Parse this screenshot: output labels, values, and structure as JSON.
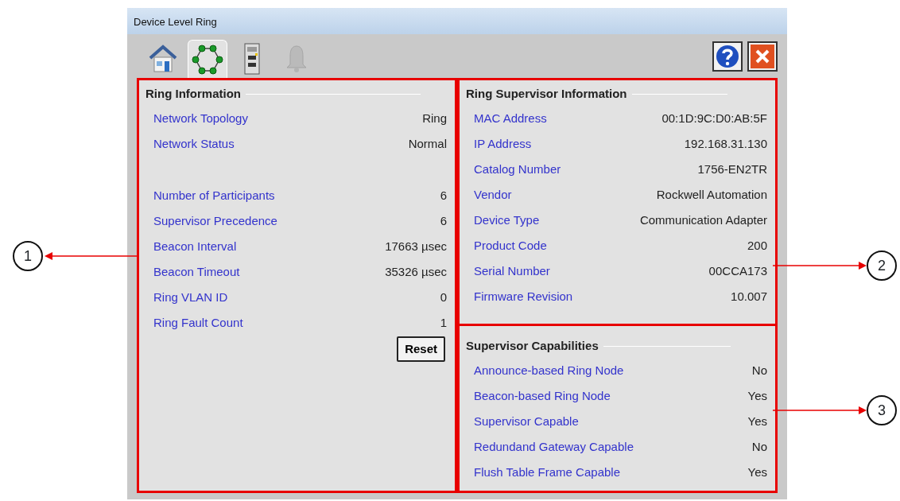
{
  "window": {
    "title": "Device Level Ring"
  },
  "tabs": [
    {
      "kind": "home",
      "selected": false,
      "disabled": false
    },
    {
      "kind": "ring",
      "selected": true,
      "disabled": false
    },
    {
      "kind": "module",
      "selected": false,
      "disabled": false
    },
    {
      "kind": "alarm",
      "selected": false,
      "disabled": true
    }
  ],
  "ring_information": {
    "title": "Ring Information",
    "row_groups": [
      [
        {
          "label": "Network Topology",
          "value": "Ring"
        },
        {
          "label": "Network Status",
          "value": "Normal"
        }
      ],
      [
        {
          "label": "Number of Participants",
          "value": "6"
        },
        {
          "label": "Supervisor Precedence",
          "value": "6"
        },
        {
          "label": "Beacon Interval",
          "value": "17663 µsec"
        },
        {
          "label": "Beacon Timeout",
          "value": "35326  µsec"
        },
        {
          "label": "Ring VLAN ID",
          "value": "0"
        },
        {
          "label": "Ring Fault Count",
          "value": "1"
        }
      ]
    ],
    "reset_button": "Reset"
  },
  "ring_supervisor_information": {
    "title": "Ring Supervisor Information",
    "rows": [
      {
        "label": "MAC Address",
        "value": "00:1D:9C:D0:AB:5F"
      },
      {
        "label": "IP Address",
        "value": "192.168.31.130"
      },
      {
        "label": "Catalog Number",
        "value": "1756-EN2TR"
      },
      {
        "label": "Vendor",
        "value": "Rockwell Automation"
      },
      {
        "label": "Device Type",
        "value": "Communication Adapter"
      },
      {
        "label": "Product Code",
        "value": "200"
      },
      {
        "label": "Serial Number",
        "value": "00CCA173"
      },
      {
        "label": "Firmware Revision",
        "value": "10.007"
      }
    ]
  },
  "supervisor_capabilities": {
    "title": "Supervisor Capabilities",
    "rows": [
      {
        "label": "Announce-based Ring Node",
        "value": "No"
      },
      {
        "label": "Beacon-based Ring Node",
        "value": "Yes"
      },
      {
        "label": "Supervisor Capable",
        "value": "Yes"
      },
      {
        "label": "Redundand Gateway Capable",
        "value": "No"
      },
      {
        "label": "Flush Table Frame Capable",
        "value": "Yes"
      }
    ]
  },
  "callouts": [
    {
      "number": "1"
    },
    {
      "number": "2"
    },
    {
      "number": "3"
    }
  ]
}
